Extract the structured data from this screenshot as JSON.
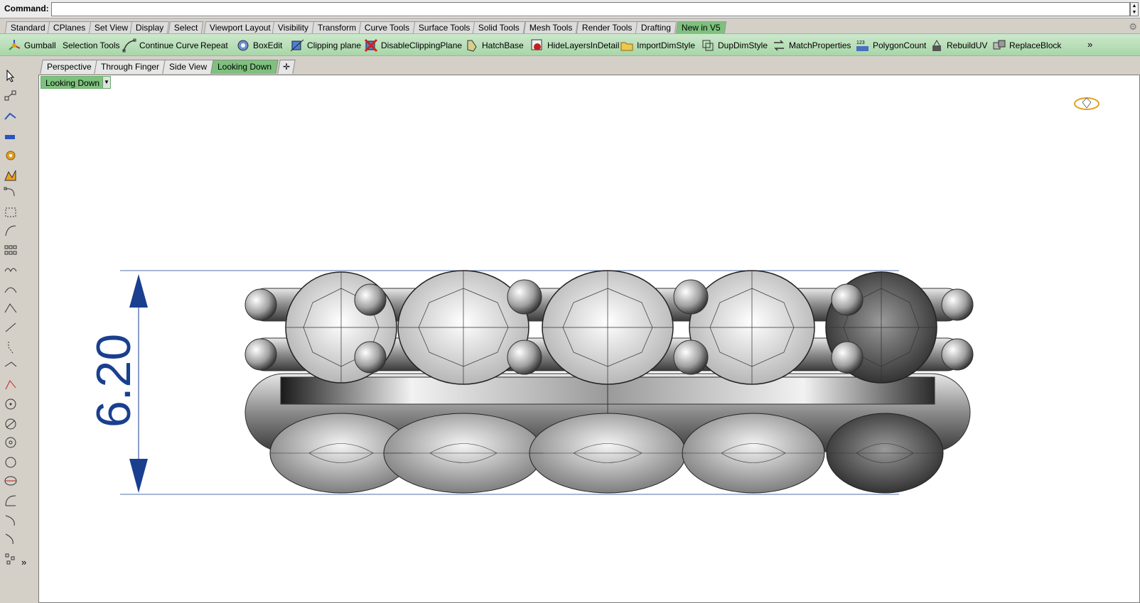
{
  "command": {
    "label": "Command:",
    "value": ""
  },
  "toolbar_tabs": [
    {
      "label": "Standard",
      "active": false
    },
    {
      "label": "CPlanes",
      "active": false
    },
    {
      "label": "Set View",
      "active": false
    },
    {
      "label": "Display",
      "active": false
    },
    {
      "label": "Select",
      "active": false
    },
    {
      "label": "Viewport Layout",
      "active": false
    },
    {
      "label": "Visibility",
      "active": false
    },
    {
      "label": "Transform",
      "active": false
    },
    {
      "label": "Curve Tools",
      "active": false
    },
    {
      "label": "Surface Tools",
      "active": false
    },
    {
      "label": "Solid Tools",
      "active": false
    },
    {
      "label": "Mesh Tools",
      "active": false
    },
    {
      "label": "Render Tools",
      "active": false
    },
    {
      "label": "Drafting",
      "active": false
    },
    {
      "label": "New in V5",
      "active": true
    }
  ],
  "toolbar": {
    "items": [
      {
        "label": "Gumball",
        "icon": "gumball-icon"
      },
      {
        "label": "Selection Tools",
        "icon": ""
      },
      {
        "label": "Continue Curve",
        "icon": "continue-curve-icon"
      },
      {
        "label": "Repeat",
        "icon": ""
      },
      {
        "label": "BoxEdit",
        "icon": "boxedit-icon"
      },
      {
        "label": "Clipping plane",
        "icon": "clipping-plane-icon"
      },
      {
        "label": "DisableClippingPlane",
        "icon": "disable-clipping-plane-icon"
      },
      {
        "label": "HatchBase",
        "icon": "hatch-base-icon"
      },
      {
        "label": "HideLayersInDetail",
        "icon": "hide-layers-icon"
      },
      {
        "label": "ImportDimStyle",
        "icon": "folder-icon"
      },
      {
        "label": "DupDimStyle",
        "icon": "dup-dim-style-icon"
      },
      {
        "label": "MatchProperties",
        "icon": "match-properties-icon"
      },
      {
        "label": "PolygonCount",
        "icon": "polygon-count-icon"
      },
      {
        "label": "RebuildUV",
        "icon": "rebuild-uv-icon"
      },
      {
        "label": "ReplaceBlock",
        "icon": "replace-block-icon"
      }
    ],
    "more": "»"
  },
  "viewport_tabs": [
    {
      "label": "Perspective",
      "active": false
    },
    {
      "label": "Through Finger",
      "active": false
    },
    {
      "label": "Side View",
      "active": false
    },
    {
      "label": "Looking Down",
      "active": true
    }
  ],
  "viewport": {
    "title": "Looking Down",
    "dimension_value": "6.20"
  },
  "left_toolbar": {
    "more": "»"
  },
  "colors": {
    "active_tab": "#7ec17e",
    "dimension": "#1a3f8f",
    "toolbar_bg": "#b8dfb8"
  }
}
